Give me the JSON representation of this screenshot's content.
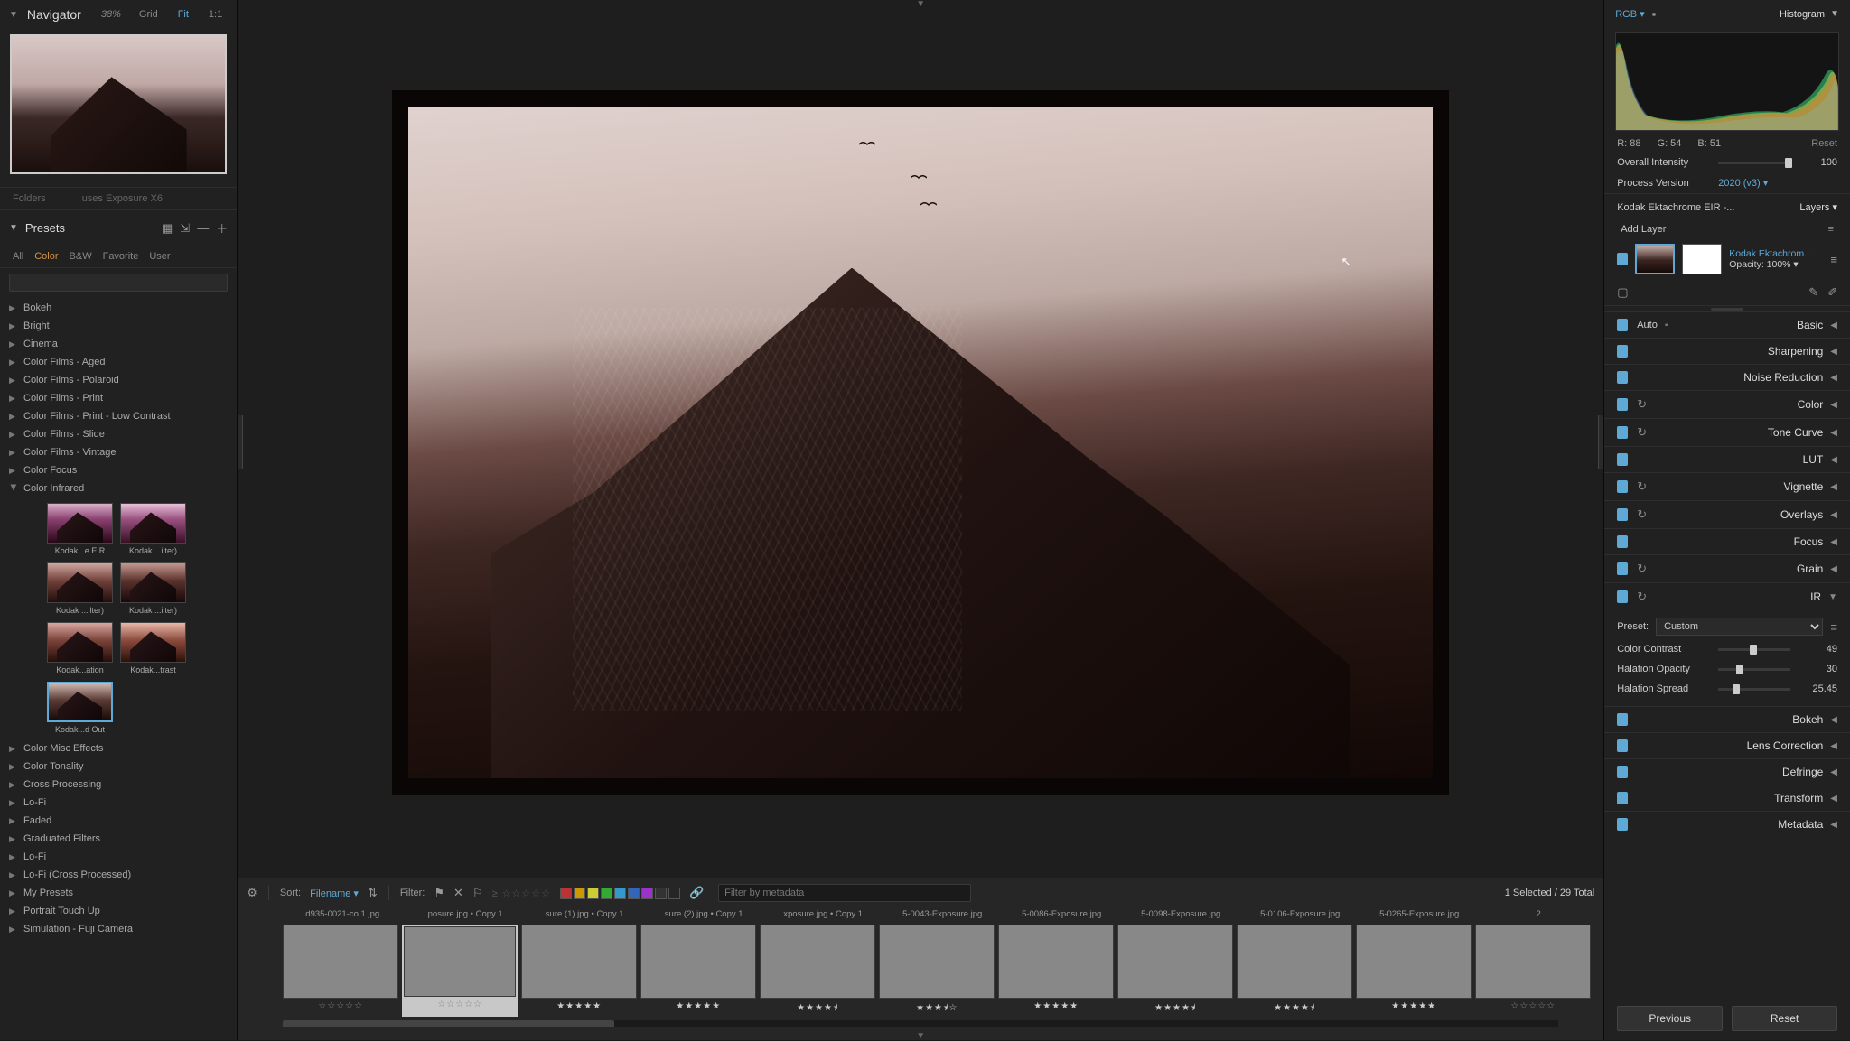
{
  "navigator": {
    "title": "Navigator",
    "zoom_pct": "38%",
    "opts": [
      "Grid",
      "Fit",
      "1:1"
    ],
    "active_opt": "Fit"
  },
  "folders_row": {
    "a": "Folders",
    "b": "uses Exposure X6"
  },
  "presets": {
    "title": "Presets",
    "filters": [
      "All",
      "Color",
      "B&W",
      "Favorite",
      "User"
    ],
    "active_filter": "Color",
    "search_placeholder": "",
    "categories": [
      {
        "name": "Bokeh"
      },
      {
        "name": "Bright"
      },
      {
        "name": "Cinema"
      },
      {
        "name": "Color Films - Aged"
      },
      {
        "name": "Color Films - Polaroid"
      },
      {
        "name": "Color Films - Print"
      },
      {
        "name": "Color Films - Print - Low Contrast"
      },
      {
        "name": "Color Films - Slide"
      },
      {
        "name": "Color Films - Vintage"
      },
      {
        "name": "Color Focus"
      },
      {
        "name": "Color Infrared",
        "expanded": true
      },
      {
        "name": "Color Misc Effects"
      },
      {
        "name": "Color Tonality"
      },
      {
        "name": "Cross Processing"
      },
      {
        "name": "Lo-Fi"
      },
      {
        "name": "Faded"
      },
      {
        "name": "Graduated Filters"
      },
      {
        "name": "Lo-Fi"
      },
      {
        "name": "Lo-Fi (Cross Processed)"
      },
      {
        "name": "My Presets"
      },
      {
        "name": "Portrait Touch Up"
      },
      {
        "name": "Simulation - Fuji Camera"
      }
    ],
    "infrared_thumbs": [
      {
        "label": "Kodak...e EIR",
        "v": "v1"
      },
      {
        "label": "Kodak ...ilter)",
        "v": "v2"
      },
      {
        "label": "Kodak ...ilter)",
        "v": "v3"
      },
      {
        "label": "Kodak ...ilter)",
        "v": "v4"
      },
      {
        "label": "Kodak...ation",
        "v": "v5"
      },
      {
        "label": "Kodak...trast",
        "v": "v6"
      },
      {
        "label": "Kodak...d Out",
        "v": "v7",
        "selected": true
      }
    ]
  },
  "filmstrip": {
    "sort_label": "Sort:",
    "sort_value": "Filename",
    "filter_label": "Filter:",
    "meta_placeholder": "Filter by metadata",
    "selection_text": "1 Selected / 29 Total",
    "chip_colors": [
      "#b33",
      "#c90",
      "#cc3",
      "#3a3",
      "#39c",
      "#36b",
      "#93c",
      "#333"
    ],
    "items": [
      {
        "name": "d935-0021-co 1.jpg",
        "stars": 0,
        "cls": "t0"
      },
      {
        "name": "...posure.jpg • Copy 1",
        "stars": 0,
        "cls": "t1",
        "selected": true
      },
      {
        "name": "...sure (1).jpg • Copy 1",
        "stars": 5,
        "cls": "t2"
      },
      {
        "name": "...sure (2).jpg • Copy 1",
        "stars": 5,
        "cls": "t3"
      },
      {
        "name": "...xposure.jpg • Copy 1",
        "stars": 4.5,
        "cls": "t4"
      },
      {
        "name": "...5-0043-Exposure.jpg",
        "stars": 3.5,
        "cls": "t5"
      },
      {
        "name": "...5-0086-Exposure.jpg",
        "stars": 5,
        "cls": "t6"
      },
      {
        "name": "...5-0098-Exposure.jpg",
        "stars": 4.5,
        "cls": "t7"
      },
      {
        "name": "...5-0106-Exposure.jpg",
        "stars": 4.5,
        "cls": "t8"
      },
      {
        "name": "...5-0265-Exposure.jpg",
        "stars": 5,
        "cls": "t9"
      },
      {
        "name": "...2",
        "stars": 0,
        "cls": "t0"
      }
    ]
  },
  "right": {
    "rgb_label": "RGB",
    "histogram_label": "Histogram",
    "readout": {
      "r": "R: 88",
      "g": "G: 54",
      "b": "B: 51",
      "reset": "Reset"
    },
    "overall": {
      "label": "Overall Intensity",
      "value": "100",
      "pos": 98
    },
    "process": {
      "label": "Process Version",
      "value": "2020 (v3)"
    },
    "current_preset": "Kodak Ektachrome EIR -...",
    "layers_label": "Layers",
    "add_layer": "Add Layer",
    "layer": {
      "name": "Kodak Ektachrom...",
      "opacity_label": "Opacity:",
      "opacity": "100%"
    },
    "panels": [
      {
        "name": "Basic",
        "auto": "Auto",
        "pin": true
      },
      {
        "name": "Sharpening"
      },
      {
        "name": "Noise Reduction"
      },
      {
        "name": "Color",
        "reset": true
      },
      {
        "name": "Tone Curve",
        "reset": true
      },
      {
        "name": "LUT"
      },
      {
        "name": "Vignette",
        "reset": true
      },
      {
        "name": "Overlays",
        "reset": true
      },
      {
        "name": "Focus"
      },
      {
        "name": "Grain",
        "reset": true
      },
      {
        "name": "IR",
        "reset": true,
        "expanded": true
      }
    ],
    "ir": {
      "preset_label": "Preset:",
      "preset_value": "Custom",
      "sliders": [
        {
          "label": "Color Contrast",
          "value": "49",
          "pos": 49
        },
        {
          "label": "Halation Opacity",
          "value": "30",
          "pos": 30
        },
        {
          "label": "Halation Spread",
          "value": "25.45",
          "pos": 25
        }
      ]
    },
    "panels_after": [
      {
        "name": "Bokeh"
      },
      {
        "name": "Lens Correction"
      },
      {
        "name": "Defringe"
      },
      {
        "name": "Transform"
      },
      {
        "name": "Metadata"
      }
    ],
    "buttons": {
      "prev": "Previous",
      "reset": "Reset"
    }
  }
}
